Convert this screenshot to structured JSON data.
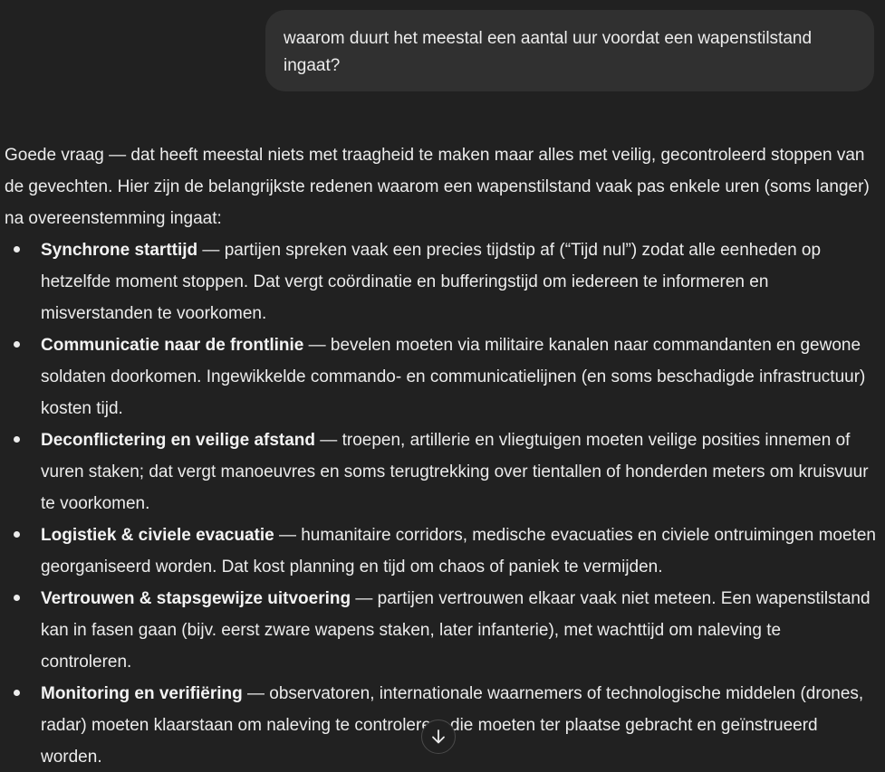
{
  "user_message": {
    "text": "waarom duurt het meestal een aantal uur voordat een wapenstilstand ingaat?"
  },
  "assistant_message": {
    "intro": "Goede vraag — dat heeft meestal niets met traagheid te maken maar alles met veilig, gecontroleerd stoppen van de gevechten. Hier zijn de belangrijkste redenen waarom een wapenstilstand vaak pas enkele uren (soms langer) na overeenstemming ingaat:",
    "bullets": [
      {
        "title": "Synchrone starttijd",
        "text": " — partijen spreken vaak een precies tijdstip af (“Tijd nul”) zodat alle eenheden op hetzelfde moment stoppen. Dat vergt coördinatie en bufferingstijd om iedereen te informeren en misverstanden te voorkomen."
      },
      {
        "title": "Communicatie naar de frontlinie",
        "text": " — bevelen moeten via militaire kanalen naar commandanten en gewone soldaten doorkomen. Ingewikkelde commando- en communicatielijnen (en soms beschadigde infrastructuur) kosten tijd."
      },
      {
        "title": "Deconflictering en veilige afstand",
        "text": " — troepen, artillerie en vliegtuigen moeten veilige posities innemen of vuren staken; dat vergt manoeuvres en soms terugtrekking over tientallen of honderden meters om kruisvuur te voorkomen."
      },
      {
        "title": "Logistiek & civiele evacuatie",
        "text": " — humanitaire corridors, medische evacuaties en civiele ontruimingen moeten georganiseerd worden. Dat kost planning en tijd om chaos of paniek te vermijden."
      },
      {
        "title": "Vertrouwen & stapsgewijze uitvoering",
        "text": " — partijen vertrouwen elkaar vaak niet meteen. Een wapenstilstand kan in fasen gaan (bijv. eerst zware wapens staken, later infanterie), met wachttijd om naleving te controleren."
      },
      {
        "title": "Monitoring en verifiëring",
        "text": " — observatoren, internationale waarnemers of technologische middelen (drones, radar) moeten klaarstaan om naleving te controleren; die moeten ter plaatse gebracht en geïnstrueerd worden."
      }
    ]
  },
  "scroll_button": {
    "icon": "arrow-down-icon"
  }
}
